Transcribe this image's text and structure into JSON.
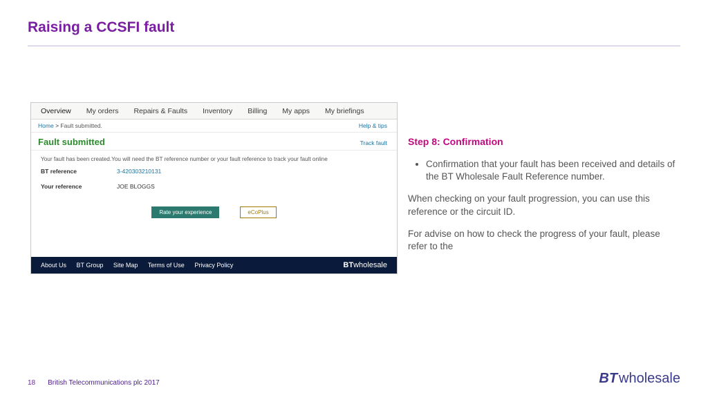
{
  "title": "Raising a CCSFI fault",
  "screenshot": {
    "tabs": [
      "Overview",
      "My orders",
      "Repairs & Faults",
      "Inventory",
      "Billing",
      "My apps",
      "My briefings"
    ],
    "breadcrumb": {
      "home": "Home",
      "sep": ">",
      "current": "Fault submitted."
    },
    "help_link": "Help & tips",
    "heading": "Fault submitted",
    "track_link": "Track fault",
    "description": "Your fault has been created.You will need the BT reference number or your fault reference to track your fault online",
    "ref_label": "BT reference",
    "ref_value": "3-420303210131",
    "your_ref_label": "Your reference",
    "your_ref_value": "JOE BLOGGS",
    "btn_rate": "Rate your experience",
    "btn_eco": "eCoPlus",
    "footer_links": [
      "About Us",
      "BT Group",
      "Site Map",
      "Terms of Use",
      "Privacy Policy"
    ],
    "footer_brand_bold": "BT",
    "footer_brand_light": "wholesale"
  },
  "explain": {
    "step_title": "Step 8: Confirmation",
    "bullet": "Confirmation that your fault has been received and details of the BT Wholesale Fault Reference number.",
    "para1": "When checking on your fault progression, you can use this reference or the circuit ID.",
    "para2": "For advise on how to check the progress of your fault, please refer to the"
  },
  "footer": {
    "page": "18",
    "copyright": "British Telecommunications plc 2017",
    "logo_bold": "BT",
    "logo_light": "wholesale"
  }
}
